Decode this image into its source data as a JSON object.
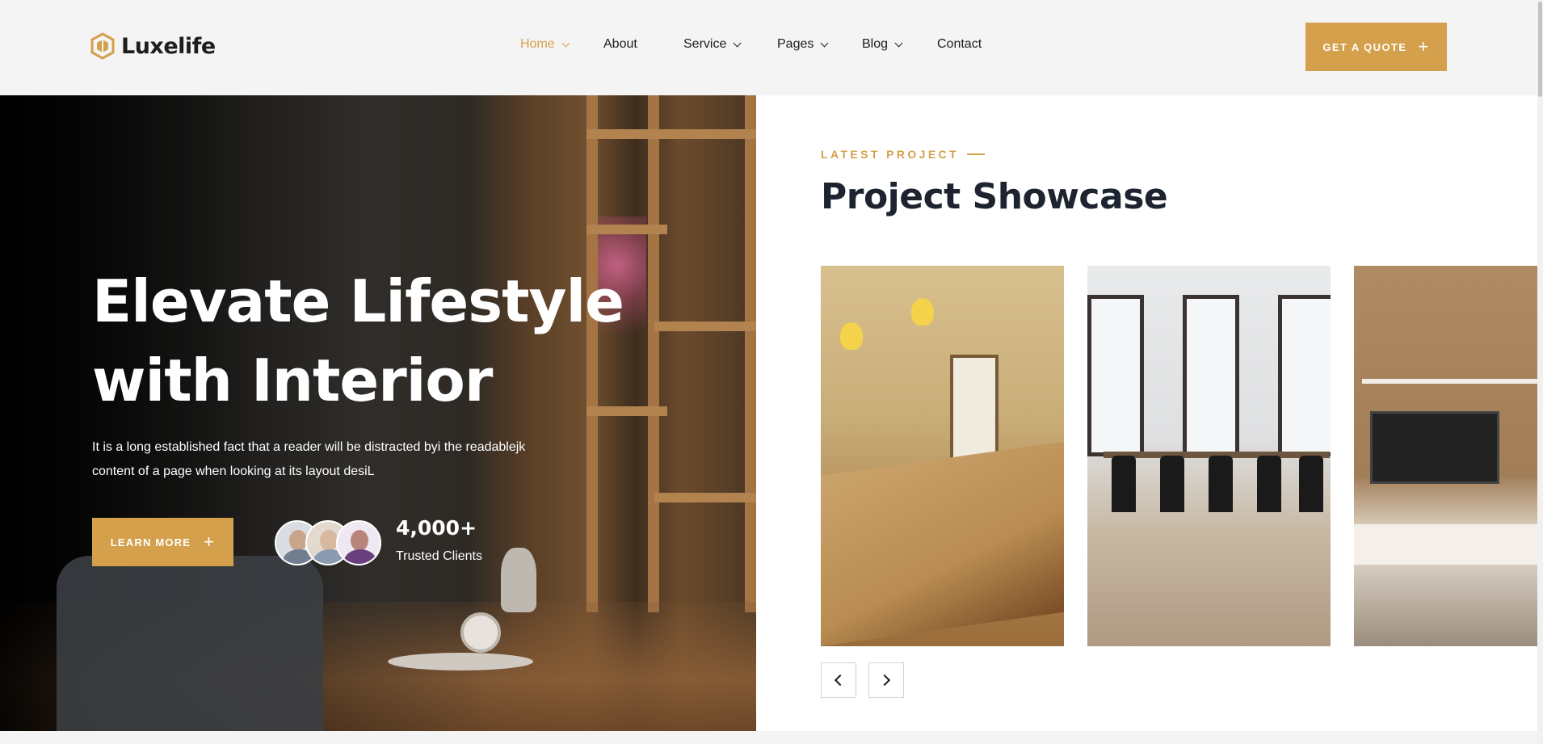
{
  "header": {
    "logo_text": "Luxelife",
    "nav": [
      {
        "label": "Home",
        "active": true,
        "dropdown": true
      },
      {
        "label": "About",
        "active": false,
        "dropdown": false
      },
      {
        "label": "Service",
        "active": false,
        "dropdown": true
      },
      {
        "label": "Pages",
        "active": false,
        "dropdown": true
      },
      {
        "label": "Blog",
        "active": false,
        "dropdown": true
      },
      {
        "label": "Contact",
        "active": false,
        "dropdown": false
      }
    ],
    "quote_label": "GET A QUOTE",
    "quote_icon": "plus-icon"
  },
  "hero": {
    "title_line1": "Elevate Lifestyle",
    "title_line2": "with Interior",
    "description_line1": "It is a long established fact that a reader will be distracted byi the readablejk",
    "description_line2": "content of a page when looking at its layout desiL",
    "button_label": "LEARN MORE",
    "button_icon": "plus-icon",
    "clients_count": "4,000+",
    "clients_label": "Trusted Clients"
  },
  "showcase": {
    "kicker": "LATEST PROJECT",
    "title": "Project Showcase",
    "projects": [
      "kitchen-project-image",
      "dining-room-project-image",
      "living-room-project-image"
    ],
    "prev_icon": "chevron-left-icon",
    "next_icon": "chevron-right-icon"
  },
  "colors": {
    "accent": "#d4a04b",
    "heading": "#1d2430",
    "header_bg": "#f4f4f4",
    "card_bg": "#ffffff"
  }
}
